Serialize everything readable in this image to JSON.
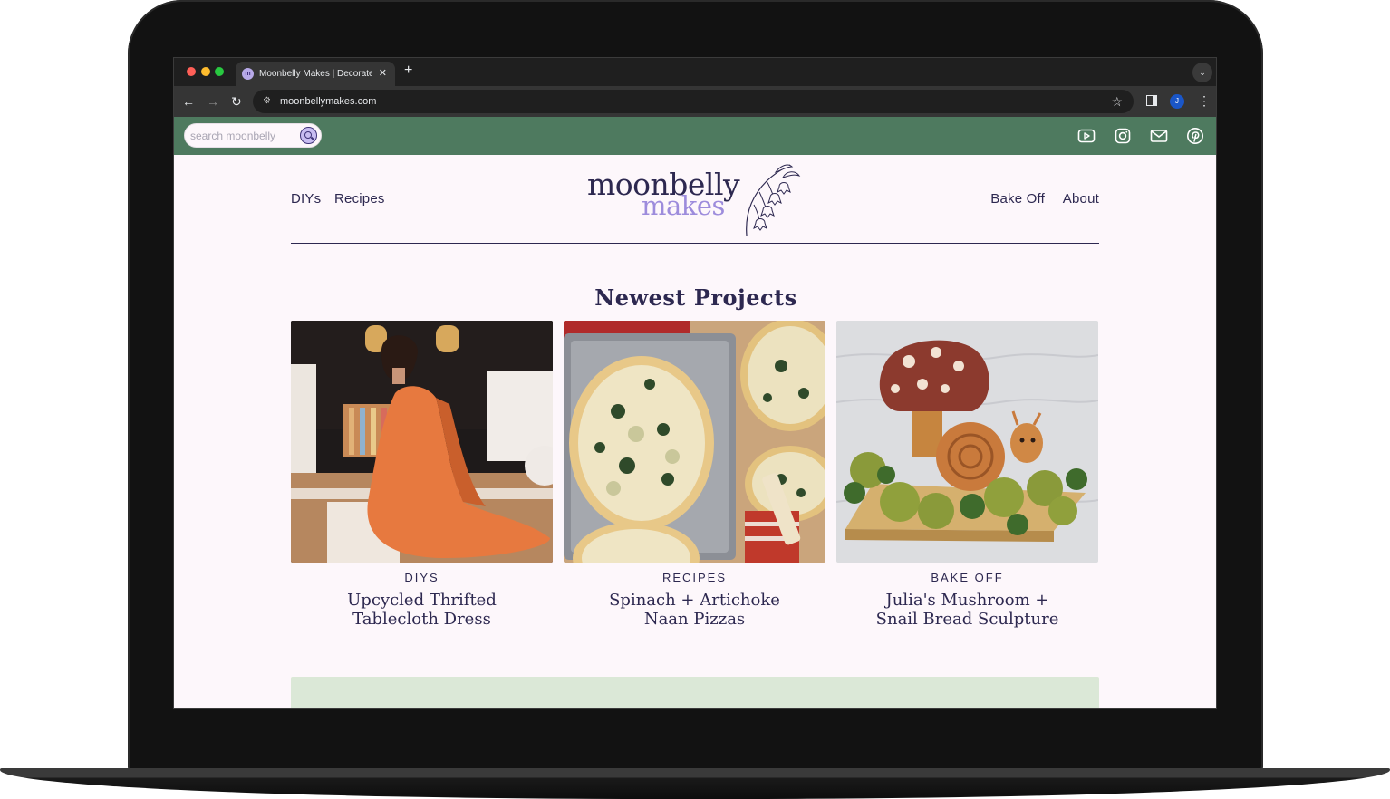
{
  "browser": {
    "tab_title": "Moonbelly Makes | Decorate",
    "tab_favicon_text": "m",
    "tab_close": "✕",
    "new_tab": "+",
    "tab_menu": "⌄",
    "url": "moonbellymakes.com",
    "avatar_letter": "J",
    "nav_back": "←",
    "nav_forward": "→",
    "reload": "↻",
    "bookmark": "☆",
    "menu": "⋮",
    "site_info": "⚙"
  },
  "topbar": {
    "search_placeholder": "search moonbelly",
    "background": "#4e7a5f",
    "social_icons": [
      "youtube-icon",
      "instagram-icon",
      "mail-icon",
      "pinterest-icon"
    ]
  },
  "header": {
    "nav_left": [
      "DIYs",
      "Recipes"
    ],
    "nav_right": [
      "Bake Off",
      "About"
    ],
    "logo_top": "moonbelly",
    "logo_bottom": "makes"
  },
  "main": {
    "section_title": "Newest Projects",
    "cards": [
      {
        "category": "DIYS",
        "title": "Upcycled Thrifted Tableclo‌th Dress"
      },
      {
        "category": "RECIPES",
        "title": "Spinach + Artichoke Naan Pizzas"
      },
      {
        "category": "BAKE OFF",
        "title": "Julia's Mushroom + Snail Bread Sculpture"
      }
    ]
  },
  "colors": {
    "ink": "#2d2850",
    "lavender": "#9d8cdc",
    "page_bg": "#fdf7fb",
    "band_green": "#dbe8d7"
  }
}
